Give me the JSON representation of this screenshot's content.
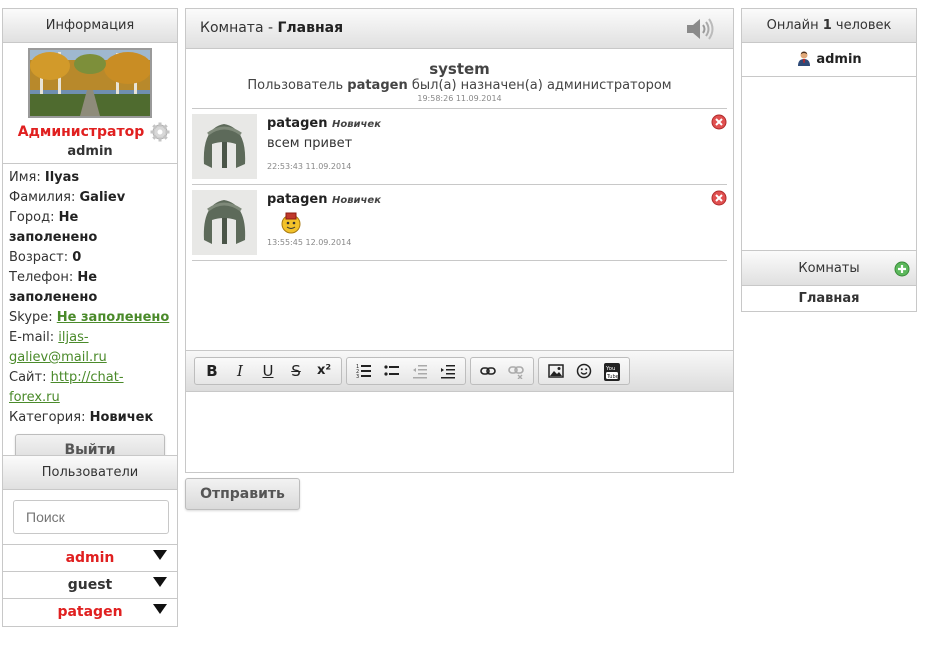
{
  "left": {
    "info_title": "Информация",
    "role": "Администратор",
    "username": "admin",
    "fields": [
      {
        "label": "Имя: ",
        "value": "Ilyas"
      },
      {
        "label": "Фамилия: ",
        "value": "Galiev"
      },
      {
        "label": "Город: ",
        "value": "Не заполенено"
      },
      {
        "label": "Возраст: ",
        "value": "0"
      },
      {
        "label": "Телефон: ",
        "value": "Не заполенено"
      },
      {
        "label": "Skype: ",
        "value": "Не заполенено"
      },
      {
        "label": "E-mail: ",
        "value": "iljas-galiev@mail.ru"
      },
      {
        "label": "Сайт: ",
        "value": "http://chat-forex.ru"
      },
      {
        "label": "Категория: ",
        "value": "Новичек"
      }
    ],
    "logout_label": "Выйти",
    "users_title": "Пользователи",
    "search_placeholder": "Поиск",
    "users": [
      {
        "name": "admin",
        "color": "#e02020"
      },
      {
        "name": "guest",
        "color": "#333333"
      },
      {
        "name": "patagen",
        "color": "#e02020"
      }
    ]
  },
  "chat": {
    "room_label": "Комната - ",
    "room_name": "Главная",
    "system": {
      "title": "system",
      "msg_pre": "Пользователь ",
      "msg_user": "patagen",
      "msg_post": " был(а) назначен(а) администратором",
      "time": "19:58:26 11.09.2014"
    },
    "messages": [
      {
        "author": "patagen",
        "rank": "Новичек",
        "text": "всем привет",
        "time": "22:53:43 11.09.2014"
      },
      {
        "author": "patagen",
        "rank": "Новичек",
        "text": "",
        "time": "13:55:45 12.09.2014"
      }
    ],
    "toolbar": [
      "B",
      "I",
      "U",
      "S",
      "x²"
    ],
    "send_label": "Отправить"
  },
  "right": {
    "online_pre": "Онлайн ",
    "online_count": "1",
    "online_post": " человек",
    "online_users": [
      "admin"
    ],
    "rooms_title": "Комнаты",
    "rooms": [
      "Главная"
    ]
  },
  "colors": {
    "accent_red": "#e02020",
    "link_green": "#4a8a2a",
    "border": "#c8c8c8"
  }
}
